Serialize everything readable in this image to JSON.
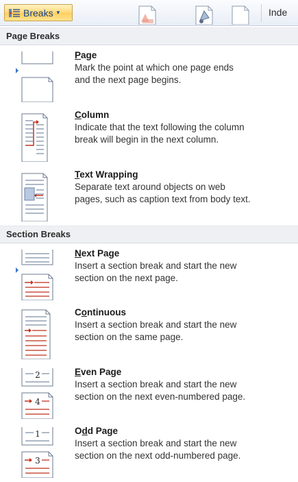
{
  "ribbon": {
    "breaks_label": "Breaks",
    "dropdown_glyph": "▾",
    "partial_label": "Inde"
  },
  "sections": [
    {
      "header": "Page Breaks",
      "items": [
        {
          "id": "page",
          "title_pre": "",
          "title_key": "P",
          "title_post": "age",
          "desc_line1": "Mark the point at which one page ends",
          "desc_line2": "and the next page begins.",
          "icon": "page-break-icon"
        },
        {
          "id": "column",
          "title_pre": "",
          "title_key": "C",
          "title_post": "olumn",
          "desc_line1": "Indicate that the text following the column",
          "desc_line2": "break will begin in the next column.",
          "icon": "column-break-icon"
        },
        {
          "id": "text-wrapping",
          "title_pre": "",
          "title_key": "T",
          "title_post": "ext Wrapping",
          "desc_line1": "Separate text around objects on web",
          "desc_line2": "pages, such as caption text from body text.",
          "icon": "text-wrapping-icon"
        }
      ]
    },
    {
      "header": "Section Breaks",
      "items": [
        {
          "id": "next-page",
          "title_pre": "",
          "title_key": "N",
          "title_post": "ext Page",
          "desc_line1": "Insert a section break and start the new",
          "desc_line2": "section on the next page.",
          "icon": "next-page-section-icon"
        },
        {
          "id": "continuous",
          "title_pre": "C",
          "title_key": "o",
          "title_post": "ntinuous",
          "desc_line1": "Insert a section break and start the new",
          "desc_line2": "section on the same page.",
          "icon": "continuous-section-icon"
        },
        {
          "id": "even-page",
          "title_pre": "",
          "title_key": "E",
          "title_post": "ven Page",
          "desc_line1": "Insert a section break and start the new",
          "desc_line2": "section on the next even-numbered page.",
          "icon": "even-page-section-icon",
          "num_top": "2",
          "num_bottom": "4"
        },
        {
          "id": "odd-page",
          "title_pre": "O",
          "title_key": "d",
          "title_post": "d Page",
          "desc_line1": "Insert a section break and start the new",
          "desc_line2": "section on the next odd-numbered page.",
          "icon": "odd-page-section-icon",
          "num_top": "1",
          "num_bottom": "3"
        }
      ]
    }
  ],
  "colors": {
    "accent_red": "#c0321e",
    "page_border": "#6b7a8f",
    "text_line": "#aeb8c6",
    "pointer": "#3a78c4"
  }
}
